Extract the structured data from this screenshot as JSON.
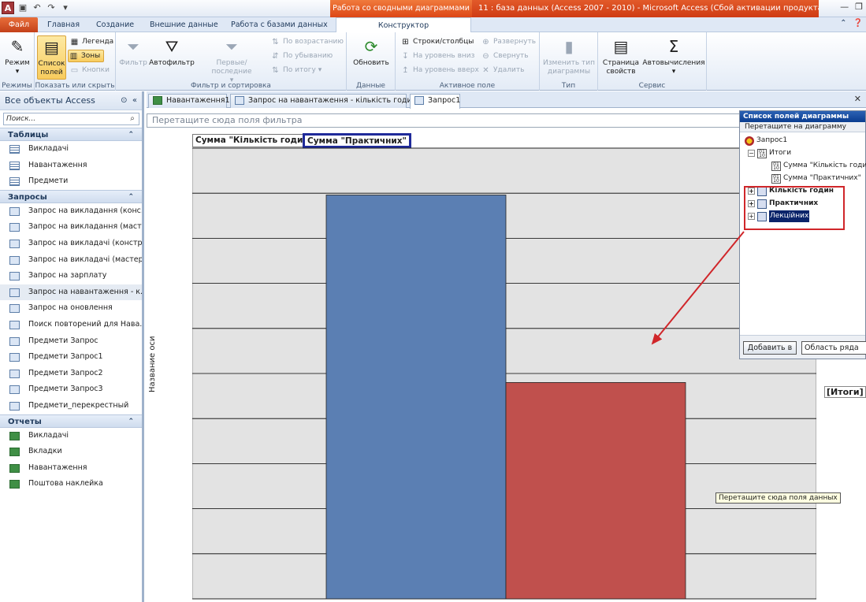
{
  "window": {
    "context_tab_title": "Работа со сводными диаграммами",
    "title": "11 : база данных (Access 2007 - 2010) - Microsoft Access (Сбой активации продукта)"
  },
  "ribbon_tabs": [
    {
      "label": "Файл"
    },
    {
      "label": "Главная"
    },
    {
      "label": "Создание"
    },
    {
      "label": "Внешние данные"
    },
    {
      "label": "Работа с базами данных"
    },
    {
      "label": "Конструктор"
    }
  ],
  "ribbon": {
    "mode_btn": "Режим",
    "modes_group": "Режимы",
    "field_list_btn": "Список полей",
    "legend_btn": "Легенда",
    "zones_btn": "Зоны",
    "buttons_btn": "Кнопки",
    "show_hide_group": "Показать или скрыть",
    "filter_btn": "Фильтр",
    "autofilter_btn": "Автофильтр",
    "first_last_btn": "Первые/последние",
    "sort_asc": "По возрастанию",
    "sort_desc": "По убыванию",
    "sort_total": "По итогу",
    "filter_sort_group": "Фильтр и сортировка",
    "refresh_btn": "Обновить",
    "data_group": "Данные",
    "rows_cols": "Строки/столбцы",
    "level_down": "На уровень вниз",
    "level_up": "На уровень вверх",
    "expand": "Развернуть",
    "collapse": "Свернуть",
    "delete": "Удалить",
    "active_field_group": "Активное поле",
    "change_type_btn": "Изменить тип диаграммы",
    "type_group": "Тип",
    "properties_btn": "Страница свойств",
    "autocalc_btn": "Автовычисления",
    "service_group": "Сервис"
  },
  "nav": {
    "header": "Все объекты Access",
    "search_placeholder": "Поиск...",
    "sections": [
      {
        "title": "Таблицы",
        "items": [
          "Викладачі",
          "Навантаження",
          "Предмети"
        ]
      },
      {
        "title": "Запросы",
        "items": [
          "Запрос на викладання (конс...",
          "Запрос на викладання (маст...",
          "Запрос на викладачі (констр)",
          "Запрос на викладачі (мастер)",
          "Запрос на зарплату",
          "Запрос на навантаження - к...",
          "Запрос на оновлення",
          "Поиск повторений для Нава...",
          "Предмети Запрос",
          "Предмети Запрос1",
          "Предмети Запрос2",
          "Предмети Запрос3",
          "Предмети_перекрестный"
        ]
      },
      {
        "title": "Отчеты",
        "items": [
          "Викладачі",
          "Вкладки",
          "Навантаження",
          "Поштова наклейка"
        ]
      }
    ]
  },
  "doc_tabs": [
    {
      "label": "Навантаження1"
    },
    {
      "label": "Запрос на навантаження - кількість годин"
    },
    {
      "label": "Запрос1"
    }
  ],
  "chart": {
    "filter_zone": "Перетащите сюда поля фильтра",
    "series_label_1": "Сумма \"Кількість годин\"",
    "series_label_2": "Сумма \"Практичних\"",
    "axis_title": "Название оси",
    "category_label": "[Итоги]",
    "data_zone_tooltip": "Перетащите сюда поля данных"
  },
  "chart_data": {
    "type": "bar",
    "categories": [
      "[Итоги]"
    ],
    "series": [
      {
        "name": "Сумма \"Кількість годин\"",
        "values": [
          224
        ],
        "color": "#5b7fb3"
      },
      {
        "name": "Сумма \"Практичних\"",
        "values": [
          120
        ],
        "color": "#c0504d"
      }
    ],
    "ylabel": "Название оси",
    "ylim": [
      0,
      250
    ],
    "yticks": [
      0,
      25,
      50,
      75,
      100,
      125,
      150,
      175,
      200,
      225,
      250
    ],
    "grid": true
  },
  "field_list": {
    "title": "Список полей диаграммы",
    "subtitle": "Перетащите на диаграмму",
    "root": "Запрос1",
    "totals": "Итоги",
    "total_fields": [
      "Сумма \"Кількість годин\"",
      "Сумма \"Практичних\""
    ],
    "fields": [
      "Кількість годин",
      "Практичних",
      "Лекційних"
    ],
    "add_button": "Добавить в",
    "area_select": "Область ряда"
  }
}
